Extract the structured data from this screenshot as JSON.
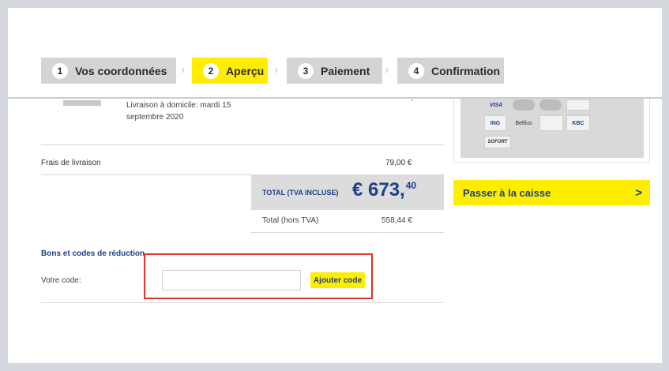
{
  "steps": [
    {
      "number": "1",
      "label": "Vos coordonnées"
    },
    {
      "number": "2",
      "label": "Aperçu"
    },
    {
      "number": "3",
      "label": "Paiement"
    },
    {
      "number": "4",
      "label": "Confirmation"
    }
  ],
  "active_step": 2,
  "order": {
    "delivery_text": "Livraison à domicile: mardi 15 septembre 2020",
    "shipping_label": "Frais de livraison",
    "shipping_value": "79,00 €",
    "total_label": "TOTAL (TVA INCLUSE)",
    "total_main": "€ 673,",
    "total_cents": "40",
    "ht_label": "Total (hors TVA)",
    "ht_value": "558,44 €"
  },
  "coupon": {
    "title": "Bons et codes de réduction",
    "label": "Votre code:",
    "input_value": "",
    "button_label": "Ajouter code"
  },
  "payment_logos": {
    "visa": "VISA",
    "ing": "ING",
    "belfius": "Belfius",
    "kbc": "KBC",
    "sofort": "SOFORT"
  },
  "checkout": {
    "label": "Passer à la caisse",
    "arrow": ">"
  },
  "colors": {
    "accent_yellow": "#ffed00",
    "brand_blue": "#1d3f8a",
    "highlight_red": "#e0332b"
  }
}
